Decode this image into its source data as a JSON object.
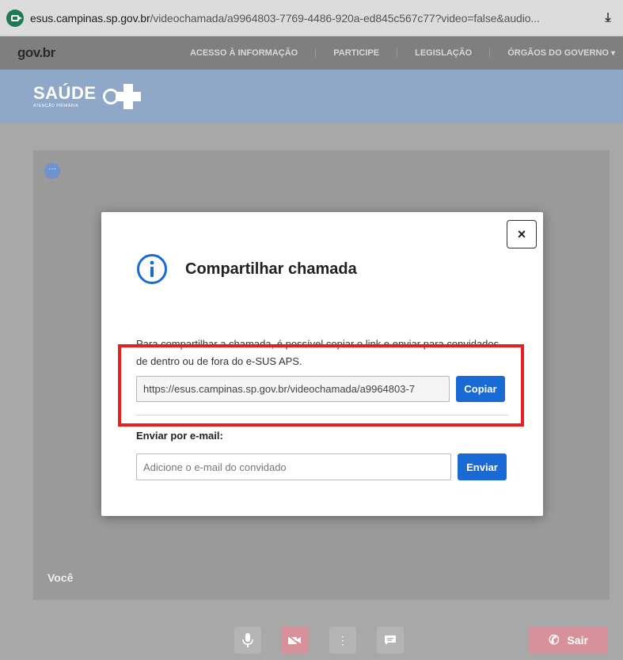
{
  "browser": {
    "url_host": "esus.campinas.sp.gov.br",
    "url_path": "/videochamada/a9964803-7769-4486-920a-ed845c567c77?video=false&audio...",
    "download_icon": "download-icon"
  },
  "govnav": {
    "logo": "gov.br",
    "links": [
      "ACESSO À INFORMAÇÃO",
      "PARTICIPE",
      "LEGISLAÇÃO",
      "ÓRGÃOS DO GOVERNO"
    ]
  },
  "banner": {
    "title": "SAÚDE",
    "subtitle": "ATENÇÃO PRIMÁRIA",
    "badge_text": "sus"
  },
  "video": {
    "self_label": "Você",
    "more_label": "···"
  },
  "controls": {
    "sair_label": "Sair"
  },
  "modal": {
    "title": "Compartilhar chamada",
    "description": "Para compartilhar a chamada, é possível copiar o link e enviar para convidados de dentro ou de fora do e-SUS APS.",
    "link_value": "https://esus.campinas.sp.gov.br/videochamada/a9964803-7",
    "copy_label": "Copiar",
    "email_label": "Enviar por e-mail:",
    "email_placeholder": "Adicione o e-mail do convidado",
    "send_label": "Enviar",
    "close_label": "×"
  },
  "colors": {
    "primary": "#1a6ad6",
    "highlight": "#e52020",
    "danger": "#d6919a"
  }
}
